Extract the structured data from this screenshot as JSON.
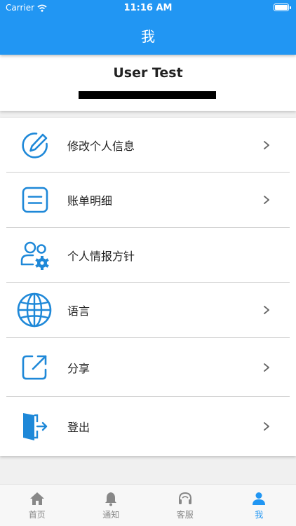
{
  "status_bar": {
    "carrier": "Carrier",
    "time": "11:16 AM"
  },
  "nav": {
    "title": "我"
  },
  "profile": {
    "name": "User Test",
    "email": "████████████"
  },
  "menu": {
    "items": [
      {
        "label": "修改个人信息",
        "icon": "edit-icon",
        "chevron": true
      },
      {
        "label": "账单明细",
        "icon": "bill-icon",
        "chevron": true
      },
      {
        "label": "个人情报方针",
        "icon": "privacy-settings-icon",
        "chevron": false
      },
      {
        "label": "语言",
        "icon": "globe-icon",
        "chevron": true
      },
      {
        "label": "分享",
        "icon": "share-icon",
        "chevron": true
      },
      {
        "label": "登出",
        "icon": "logout-icon",
        "chevron": true
      }
    ]
  },
  "tabbar": {
    "tabs": [
      {
        "label": "首页",
        "icon": "home-icon",
        "active": false
      },
      {
        "label": "通知",
        "icon": "bell-icon",
        "active": false
      },
      {
        "label": "客服",
        "icon": "headset-icon",
        "active": false
      },
      {
        "label": "我",
        "icon": "person-icon",
        "active": true
      }
    ]
  },
  "colors": {
    "primary": "#2196f3",
    "icon_blue": "#1e88d8",
    "tab_inactive": "#888888"
  }
}
